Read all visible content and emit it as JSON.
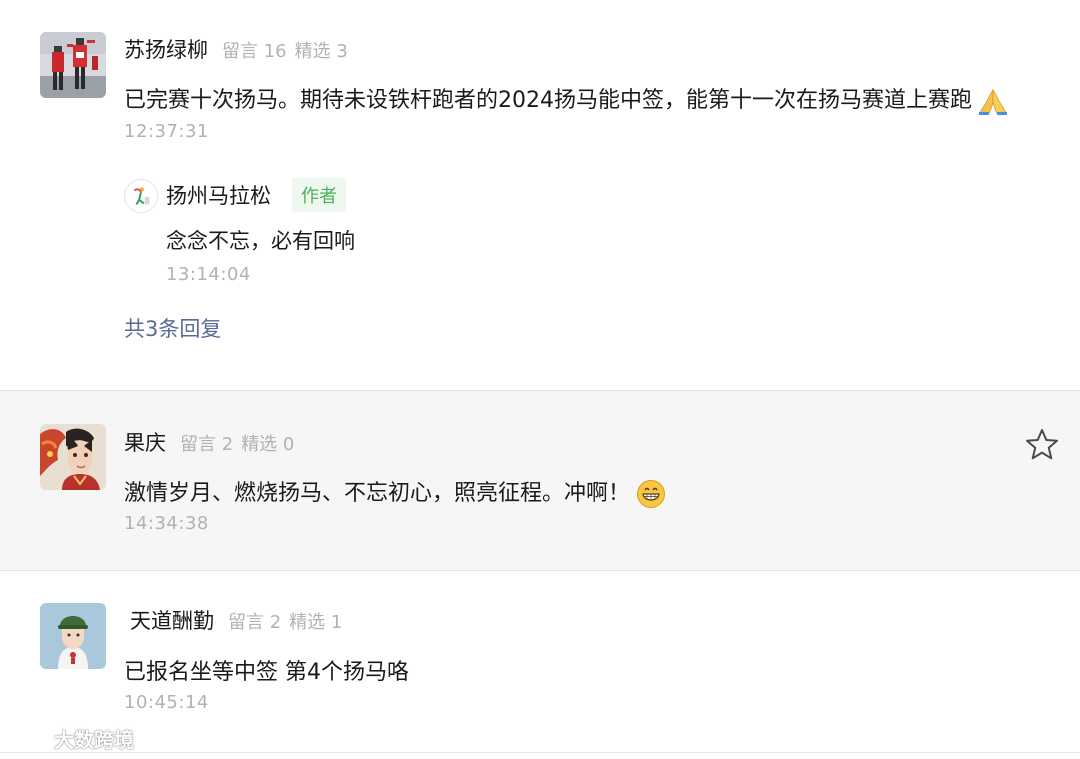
{
  "comments": [
    {
      "nickname": "苏扬绿柳",
      "liuyan_label": "留言 16",
      "jingxuan_label": "精选 3",
      "text": "已完赛十次扬马。期待未设铁杆跑者的2024扬马能中签，能第十一次在扬马赛道上赛跑",
      "emoji": "folded-hands",
      "time": "12:37:31",
      "reply": {
        "nickname": "扬州马拉松",
        "badge": "作者",
        "text": "念念不忘，必有回响",
        "time": "13:14:04"
      },
      "reply_count_label": "共3条回复"
    },
    {
      "nickname": "果庆",
      "liuyan_label": "留言 2",
      "jingxuan_label": "精选 0",
      "text": "激情岁月、燃烧扬马、不忘初心，照亮征程。冲啊！",
      "emoji": "grinning-face",
      "time": "14:34:38"
    },
    {
      "nickname": "天道酬勤",
      "liuyan_label": "留言 2",
      "jingxuan_label": "精选 1",
      "text": "已报名坐等中签  第4个扬马咯",
      "time": "10:45:14"
    }
  ],
  "watermark": "大数跨境",
  "icons": {
    "favorite": "star-outline-icon"
  },
  "colors": {
    "link": "#576b95",
    "badge_text": "#4cb05a",
    "badge_bg": "#eef8ef",
    "meta": "#b2b2b2",
    "highlight_bg": "#f6f6f6"
  }
}
